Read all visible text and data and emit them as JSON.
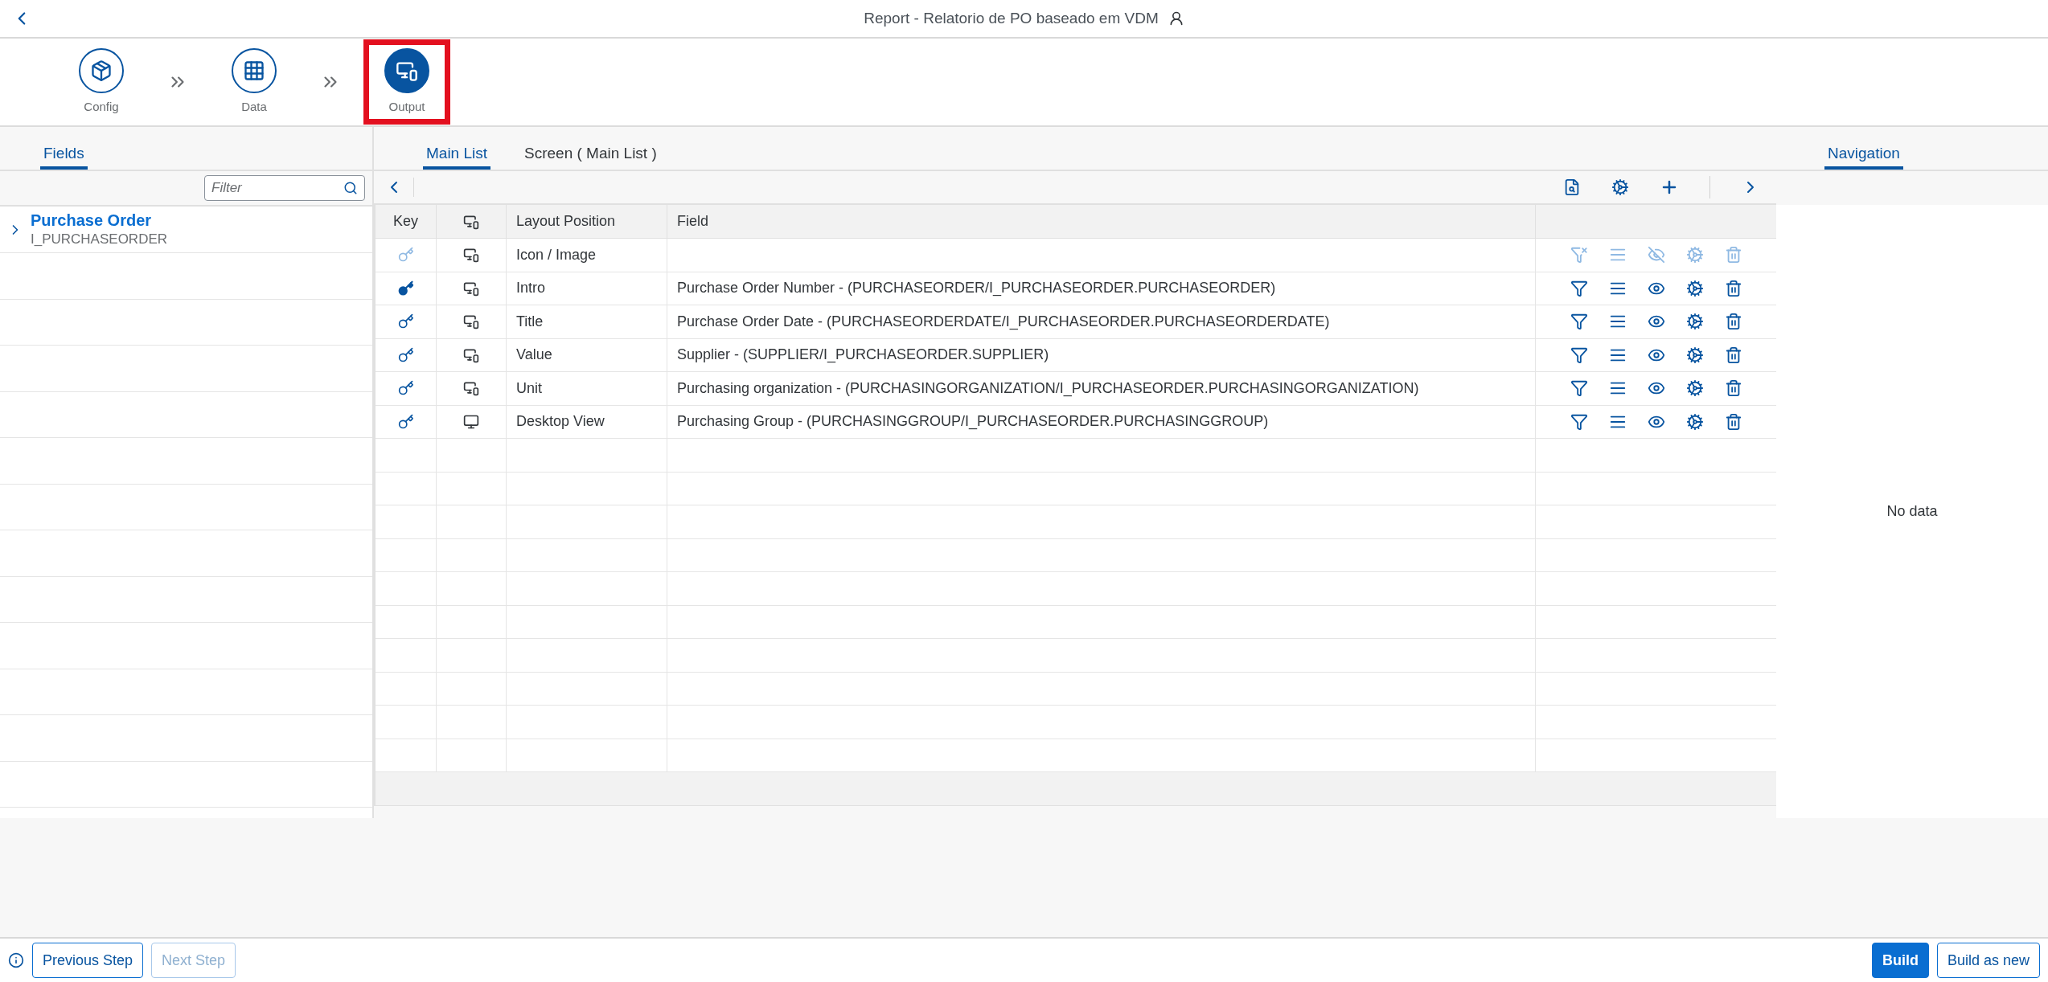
{
  "header": {
    "title": "Report - Relatorio de PO baseado em VDM"
  },
  "steps": [
    {
      "label": "Config",
      "selected": false,
      "highlighted": false
    },
    {
      "label": "Data",
      "selected": false,
      "highlighted": false
    },
    {
      "label": "Output",
      "selected": true,
      "highlighted": true
    }
  ],
  "fields_panel": {
    "tabs": [
      {
        "label": "Fields",
        "selected": true
      }
    ],
    "filter": {
      "placeholder": "Filter"
    },
    "tree": [
      {
        "title": "Purchase Order",
        "subtitle": "I_PURCHASEORDER",
        "expanded": false
      }
    ]
  },
  "main_panel": {
    "tabs": [
      {
        "label": "Main List",
        "selected": true
      },
      {
        "label": "Screen ( Main List )",
        "selected": false
      }
    ],
    "table": {
      "columns": [
        "Key",
        "",
        "Layout Position",
        "Field"
      ],
      "rows": [
        {
          "is_key": false,
          "desktop_only": false,
          "layout_position": "Icon / Image",
          "field": "",
          "enabled": false
        },
        {
          "is_key": true,
          "desktop_only": false,
          "layout_position": "Intro",
          "field": "Purchase Order Number - (PURCHASEORDER/I_PURCHASEORDER.PURCHASEORDER)",
          "enabled": true
        },
        {
          "is_key": false,
          "desktop_only": false,
          "layout_position": "Title",
          "field": "Purchase Order Date - (PURCHASEORDERDATE/I_PURCHASEORDER.PURCHASEORDERDATE)",
          "enabled": true
        },
        {
          "is_key": false,
          "desktop_only": false,
          "layout_position": "Value",
          "field": "Supplier - (SUPPLIER/I_PURCHASEORDER.SUPPLIER)",
          "enabled": true
        },
        {
          "is_key": false,
          "desktop_only": false,
          "layout_position": "Unit",
          "field": "Purchasing organization - (PURCHASINGORGANIZATION/I_PURCHASEORDER.PURCHASINGORGANIZATION)",
          "enabled": true
        },
        {
          "is_key": false,
          "desktop_only": true,
          "layout_position": "Desktop View",
          "field": "Purchasing Group - (PURCHASINGGROUP/I_PURCHASEORDER.PURCHASINGGROUP)",
          "enabled": true
        }
      ]
    }
  },
  "navigation_panel": {
    "tabs": [
      {
        "label": "Navigation",
        "selected": true
      }
    ],
    "empty_text": "No data"
  },
  "footer": {
    "buttons": [
      {
        "label": "Previous Step",
        "disabled": false
      },
      {
        "label": "Next Step",
        "disabled": true
      }
    ],
    "right_buttons": [
      {
        "label": "Build",
        "kind": "primary",
        "disabled": false
      },
      {
        "label": "Build as new",
        "kind": "secondary",
        "disabled": false
      }
    ]
  }
}
